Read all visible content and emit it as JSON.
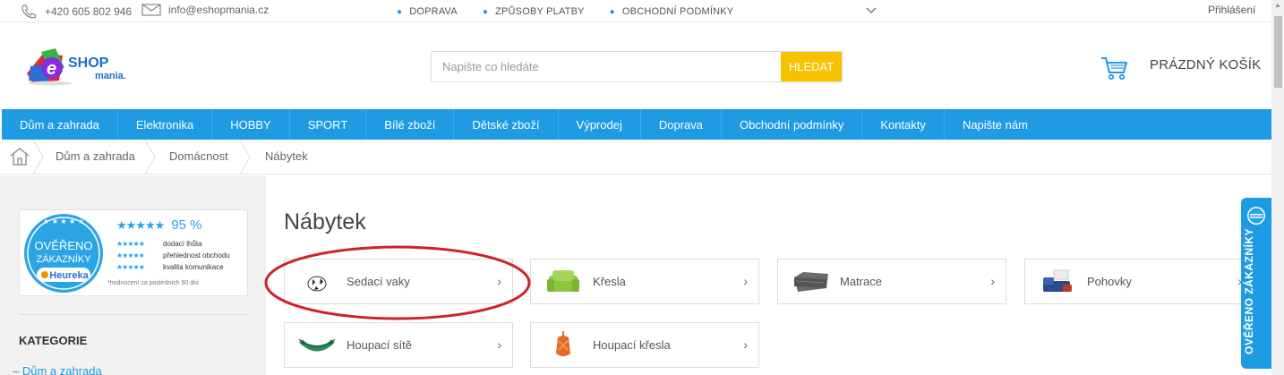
{
  "topbar": {
    "phone": "+420 605 802 946",
    "email": "info@eshopmania.cz",
    "links": [
      "DOPRAVA",
      "ZPŮSOBY PLATBY",
      "OBCHODNÍ PODMÍNKY"
    ],
    "login": "Přihlášení"
  },
  "logo": {
    "text_shop": "SHOP",
    "text_mania": "mania.",
    "letter": "e"
  },
  "search": {
    "placeholder": "Napište co hledáte",
    "value": "",
    "button": "HLEDAT"
  },
  "cart": {
    "label": "PRÁZDNÝ KOŠÍK"
  },
  "nav": {
    "items": [
      "Dům a zahrada",
      "Elektronika",
      "HOBBY",
      "SPORT",
      "Bílé zboží",
      "Dětské zboží",
      "Výprodej",
      "Doprava",
      "Obchodní podmínky",
      "Kontakty",
      "Napište nám"
    ]
  },
  "breadcrumb": {
    "items": [
      "Dům a zahrada",
      "Domácnost",
      "Nábytek"
    ]
  },
  "heureka": {
    "badge_line1": "OVĚŘENO",
    "badge_line2": "ZÁKAZNÍKY",
    "brand": "Heureka",
    "score_stars": "★★★★★",
    "score": "95 %",
    "rows": [
      {
        "stars": "★★★★★",
        "label": "dodací lhůta"
      },
      {
        "stars": "★★★★★",
        "label": "přehlednost obchodu"
      },
      {
        "stars": "★★★★★",
        "label": "kvalita komunikace"
      }
    ],
    "note": "*hodnocení za posledních 90 dní"
  },
  "sidebar": {
    "title": "KATEGORIE",
    "first_item": "– Dům a zahrada"
  },
  "page_title": "Nábytek",
  "categories": [
    {
      "name": "Sedací vaky",
      "arrow": "›"
    },
    {
      "name": "Křesla",
      "arrow": "›"
    },
    {
      "name": "Matrace",
      "arrow": "›"
    },
    {
      "name": "Pohovky",
      "arrow": "›"
    },
    {
      "name": "Houpací sítě",
      "arrow": "›"
    },
    {
      "name": "Houpací křesla",
      "arrow": "›"
    }
  ],
  "widget": {
    "label": "OVĚŘENO ZÁKAZNÍKY",
    "mini": "OVĚŘENO ZÁKAZNÍKY"
  },
  "colors": {
    "nav_blue": "#1e9be3",
    "search_button": "#f7c200",
    "annotation": "#d0202a"
  }
}
